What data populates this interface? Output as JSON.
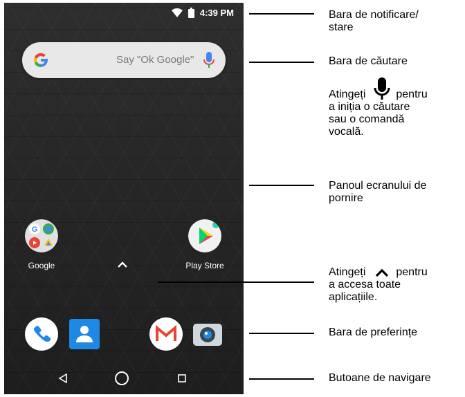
{
  "status": {
    "time": "4:39 PM"
  },
  "search": {
    "placeholder": "Say \"Ok Google\""
  },
  "apps": {
    "google": "Google",
    "play_store": "Play Store"
  },
  "annotations": {
    "notification_bar": [
      "Bara de notificare/",
      "stare"
    ],
    "search_bar": "Bara de căutare",
    "voice_tip": [
      "Atingeți",
      "pentru",
      "a iniția o căutare",
      "sau o comandă",
      "vocală."
    ],
    "home_panel": [
      "Panoul ecranului de",
      "pornire"
    ],
    "apps_tip": [
      "Atingeți",
      "pentru",
      "a accesa toate",
      "aplicațiile."
    ],
    "favorites_bar": "Bara de preferințe",
    "nav_buttons": "Butoane de navigare"
  },
  "colors": {
    "accent_red": "#ea4335",
    "accent_blue": "#4285f4",
    "accent_green": "#34a853",
    "accent_yellow": "#fbbc05"
  }
}
